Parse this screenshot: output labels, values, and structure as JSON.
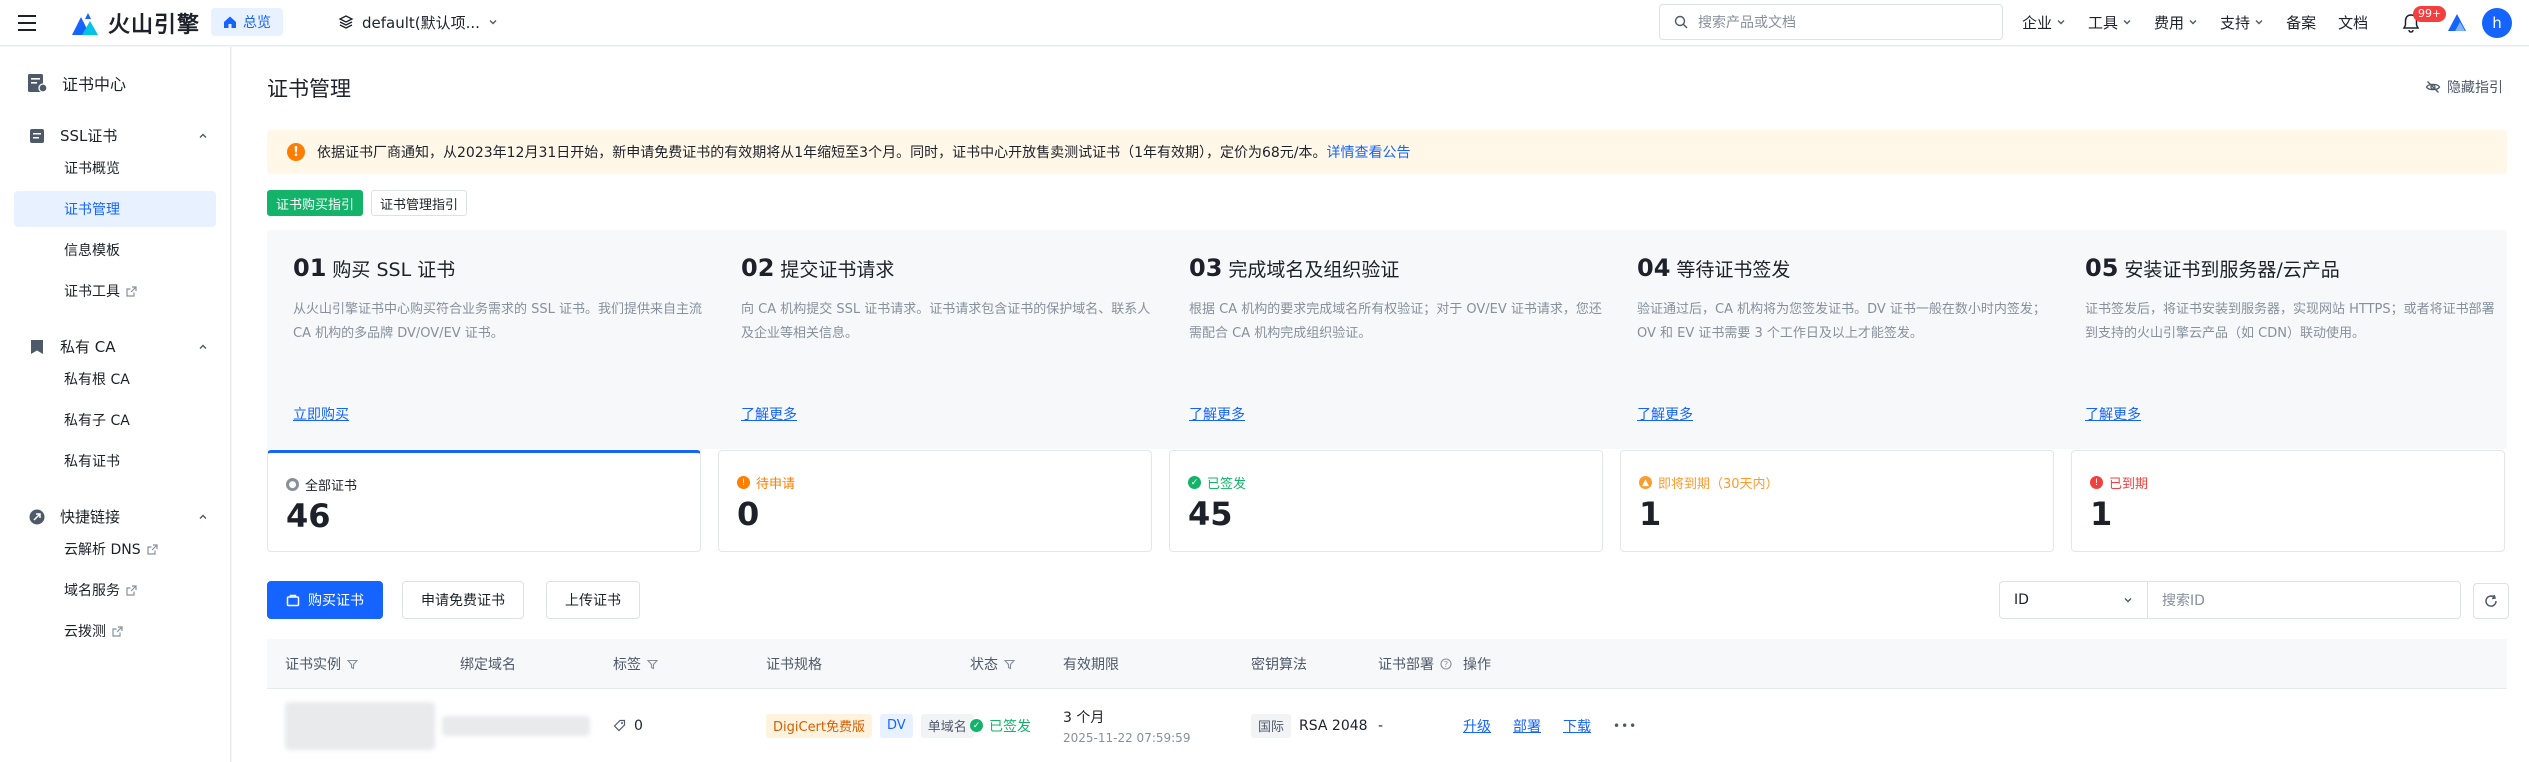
{
  "header": {
    "logo_text": "火山引擎",
    "home_label": "总览",
    "project_label": "default(默认项...",
    "search_placeholder": "搜索产品或文档",
    "nav": [
      {
        "label": "企业",
        "has_menu": true
      },
      {
        "label": "工具",
        "has_menu": true
      },
      {
        "label": "费用",
        "has_menu": true
      },
      {
        "label": "支持",
        "has_menu": true
      },
      {
        "label": "备案",
        "has_menu": false
      },
      {
        "label": "文档",
        "has_menu": false
      }
    ],
    "notification_count": "99+",
    "avatar_initial": "h"
  },
  "sidebar": {
    "title": "证书中心",
    "groups": [
      {
        "label": "SSL证书",
        "items": [
          {
            "label": "证书概览",
            "external": false,
            "active": false
          },
          {
            "label": "证书管理",
            "external": false,
            "active": true
          },
          {
            "label": "信息模板",
            "external": false,
            "active": false
          },
          {
            "label": "证书工具",
            "external": true,
            "active": false
          }
        ]
      },
      {
        "label": "私有 CA",
        "items": [
          {
            "label": "私有根 CA",
            "external": false,
            "active": false
          },
          {
            "label": "私有子 CA",
            "external": false,
            "active": false
          },
          {
            "label": "私有证书",
            "external": false,
            "active": false
          }
        ]
      },
      {
        "label": "快捷链接",
        "items": [
          {
            "label": "云解析 DNS",
            "external": true,
            "active": false
          },
          {
            "label": "域名服务",
            "external": true,
            "active": false
          },
          {
            "label": "云拨测",
            "external": true,
            "active": false
          }
        ]
      }
    ]
  },
  "main": {
    "title": "证书管理",
    "hide_guide": "隐藏指引",
    "notice_text": "依据证书厂商通知，从2023年12月31日开始，新申请免费证书的有效期将从1年缩短至3个月。同时，证书中心开放售卖测试证书（1年有效期），定价为68元/本。",
    "notice_link": "详情查看公告",
    "guide_tabs": [
      "证书购买指引",
      "证书管理指引"
    ],
    "steps": [
      {
        "num": "01",
        "title": "购买 SSL 证书",
        "desc": "从火山引擎证书中心购买符合业务需求的 SSL 证书。我们提供来自主流 CA 机构的多品牌 DV/OV/EV 证书。",
        "link": "立即购买"
      },
      {
        "num": "02",
        "title": "提交证书请求",
        "desc": "向 CA 机构提交 SSL 证书请求。证书请求包含证书的保护域名、联系人及企业等相关信息。",
        "link": "了解更多"
      },
      {
        "num": "03",
        "title": "完成域名及组织验证",
        "desc": "根据 CA 机构的要求完成域名所有权验证；对于 OV/EV 证书请求，您还需配合 CA 机构完成组织验证。",
        "link": "了解更多"
      },
      {
        "num": "04",
        "title": "等待证书签发",
        "desc": "验证通过后，CA 机构将为您签发证书。DV 证书一般在数小时内签发；OV 和 EV 证书需要 3 个工作日及以上才能签发。",
        "link": "了解更多"
      },
      {
        "num": "05",
        "title": "安装证书到服务器/云产品",
        "desc": "证书签发后，将证书安装到服务器，实现网站 HTTPS；或者将证书部署到支持的火山引擎云产品（如 CDN）联动使用。",
        "link": "了解更多"
      }
    ],
    "stats": [
      {
        "label": "全部证书",
        "value": "46",
        "color": "#86909c"
      },
      {
        "label": "待申请",
        "value": "0",
        "color": "#ff7d00"
      },
      {
        "label": "已签发",
        "value": "45",
        "color": "#14b36a"
      },
      {
        "label": "即将到期（30天内）",
        "value": "1",
        "color": "#ff9a2e"
      },
      {
        "label": "已到期",
        "value": "1",
        "color": "#f53f3f"
      }
    ],
    "buttons": {
      "buy": "购买证书",
      "free": "申请免费证书",
      "upload": "上传证书"
    },
    "filter": {
      "field": "ID",
      "placeholder": "搜索ID"
    },
    "table": {
      "columns": [
        "证书实例",
        "绑定域名",
        "标签",
        "证书规格",
        "状态",
        "有效期限",
        "密钥算法",
        "证书部署",
        "操作"
      ],
      "rows": [
        {
          "domain_suffix": "com",
          "tag_count": "0",
          "spec": [
            "DigiCert免费版",
            "DV",
            "单域名"
          ],
          "status": "已签发",
          "validity": "3 个月",
          "expiry": "2025-11-22 07:59:59",
          "algo_region": "国际",
          "algo": "RSA 2048",
          "deploy": "-",
          "actions": [
            "升级",
            "部署",
            "下载"
          ]
        }
      ]
    }
  }
}
